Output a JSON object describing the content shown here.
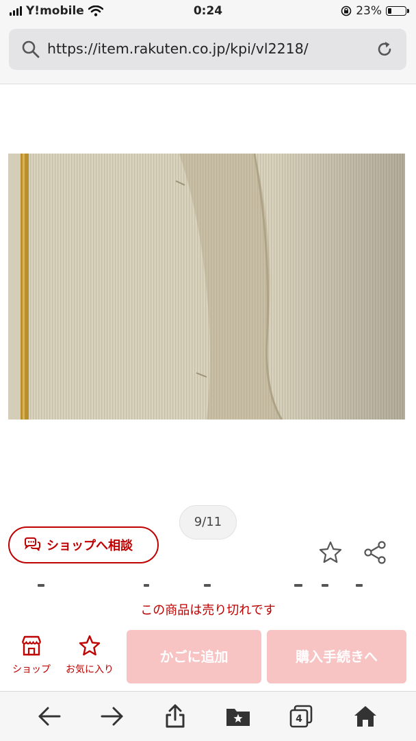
{
  "status_bar": {
    "carrier": "Y!mobile",
    "time": "0:24",
    "battery_percent": "23%",
    "battery_level": 0.23
  },
  "address_bar": {
    "url": "https://item.rakuten.co.jp/kpi/vl2218/"
  },
  "product": {
    "image_counter": "9/11",
    "consult_button_label": "ショップへ相談",
    "sold_out_message": "この商品は売り切れです"
  },
  "purchase_bar": {
    "shop_label": "ショップ",
    "favorite_label": "お気に入り",
    "add_to_cart_label": "かごに追加",
    "checkout_label": "購入手続きへ"
  },
  "browser_toolbar": {
    "tab_count": "4"
  },
  "colors": {
    "accent": "#bf0000",
    "disabled_button": "#f7c3c3",
    "garment": "#d8d2bd",
    "zipper": "#b8902e"
  },
  "icons": [
    "signal-icon",
    "wifi-icon",
    "orientation-lock-icon",
    "battery-icon",
    "search-icon",
    "reload-icon",
    "chat-icon",
    "star-icon",
    "share-icon",
    "shop-icon",
    "back-arrow-icon",
    "forward-arrow-icon",
    "upload-icon",
    "bookmarks-icon",
    "tabs-icon",
    "home-icon"
  ]
}
